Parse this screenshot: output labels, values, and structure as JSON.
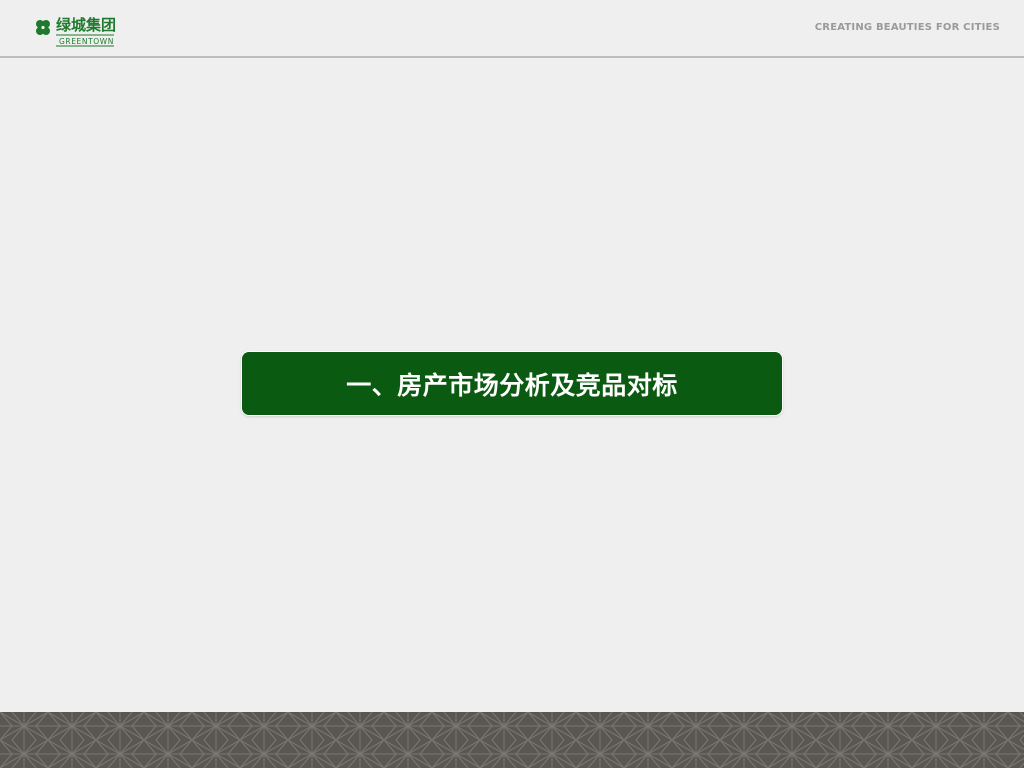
{
  "header": {
    "logo": {
      "brand_cn": "绿城集团",
      "brand_en": "GREENTOWN",
      "icon": "greentown-clover-logo",
      "color": "#1f7a2e"
    },
    "slogan": "CREATING BEAUTIES FOR CITIES"
  },
  "main": {
    "section_title": "一、房产市场分析及竞品对标",
    "box_color": "#0b5a12"
  },
  "footer": {
    "pattern": "asanoha-geometric-pattern",
    "color": "#5a5753"
  }
}
